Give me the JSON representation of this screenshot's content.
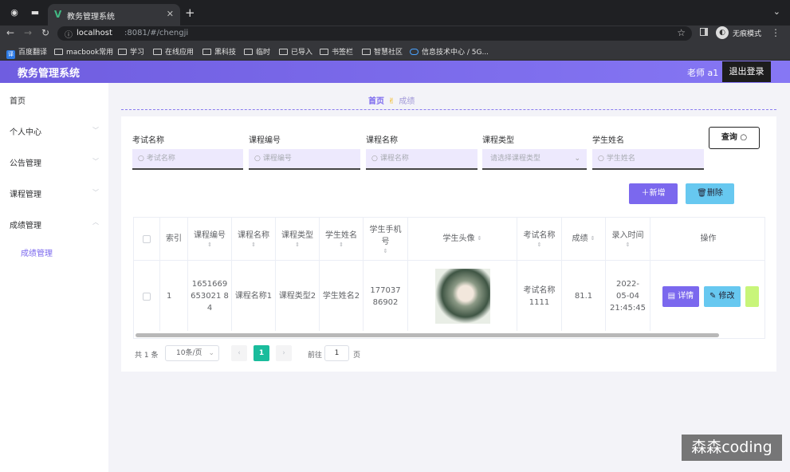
{
  "browser": {
    "tab_title": "教务管理系统",
    "url_host": "localhost",
    "url_path": ":8081/#/chengji",
    "profile_label": "无痕模式",
    "bookmarks": [
      "百度翻译",
      "macbook常用",
      "学习",
      "在线应用",
      "黑科技",
      "临时",
      "已导入",
      "书签栏",
      "智慧社区",
      "信息技术中心 / 5G..."
    ]
  },
  "header": {
    "title": "教务管理系统",
    "user": "老师 a1",
    "logout": "退出登录"
  },
  "sidebar": {
    "items": [
      "首页",
      "个人中心",
      "公告管理",
      "课程管理",
      "成绩管理"
    ],
    "sub_active": "成绩管理"
  },
  "breadcrumb": {
    "home": "首页",
    "current": "成绩"
  },
  "search": {
    "fields": [
      {
        "label": "考试名称",
        "placeholder": "考试名称"
      },
      {
        "label": "课程编号",
        "placeholder": "课程编号"
      },
      {
        "label": "课程名称",
        "placeholder": "课程名称"
      },
      {
        "label": "课程类型",
        "placeholder": "请选择课程类型"
      },
      {
        "label": "学生姓名",
        "placeholder": "学生姓名"
      }
    ],
    "query_button": "查询"
  },
  "actions": {
    "add": "新增",
    "delete": "删除"
  },
  "table": {
    "headers": [
      "索引",
      "课程编号",
      "课程名称",
      "课程类型",
      "学生姓名",
      "学生手机号",
      "学生头像",
      "考试名称",
      "成绩",
      "录入时间",
      "操作"
    ],
    "row": {
      "index": "1",
      "course_no": "1651669653021 84",
      "course_name": "课程名称1",
      "course_type": "课程类型2",
      "student_name": "学生姓名2",
      "phone": "17703786902",
      "exam_name": "考试名称1111",
      "score": "81.1",
      "entry_time": "2022-05-04 21:45:45",
      "ops": [
        "详情",
        "修改"
      ]
    }
  },
  "pagination": {
    "total": "共 1 条",
    "page_size": "10条/页",
    "current": "1",
    "goto_label": "前往",
    "goto_value": "1",
    "goto_unit": "页"
  },
  "watermark": "森森coding"
}
